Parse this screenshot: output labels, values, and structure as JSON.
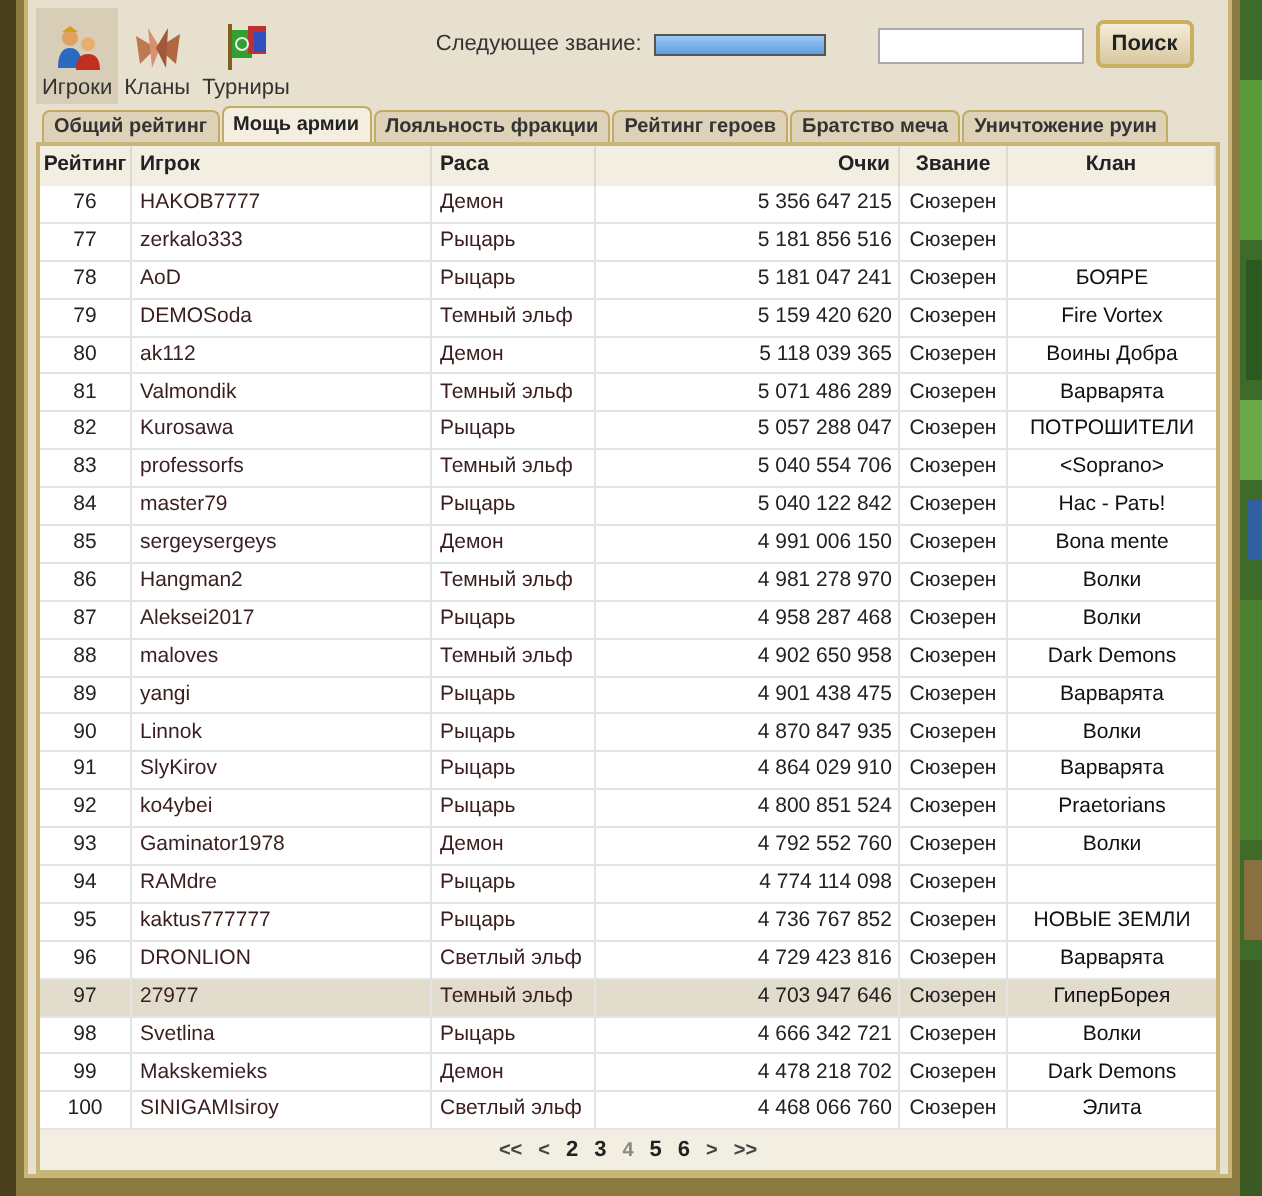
{
  "nav": [
    {
      "kind": "players",
      "label": "Игроки",
      "selected": true
    },
    {
      "kind": "clans",
      "label": "Кланы",
      "selected": false
    },
    {
      "kind": "tournaments",
      "label": "Турниры",
      "selected": false
    }
  ],
  "next_rank": {
    "label": "Следующее звание:",
    "level": 1
  },
  "search": {
    "button": "Поиск"
  },
  "tabs": [
    {
      "label": "Общий рейтинг",
      "selected": false
    },
    {
      "label": "Мощь армии",
      "selected": true
    },
    {
      "label": "Лояльность фракции",
      "selected": false
    },
    {
      "label": "Рейтинг героев",
      "selected": false
    },
    {
      "label": "Братство меча",
      "selected": false
    },
    {
      "label": "Уничтожение руин",
      "selected": false
    }
  ],
  "table": {
    "columns": [
      "Рейтинг",
      "Игрок",
      "Раса",
      "Очки",
      "Звание",
      "Клан"
    ],
    "rows": [
      {
        "rank": "76",
        "player": "HAKOB7777",
        "race": "Демон",
        "points": "5 356 647 215",
        "title": "Сюзерен",
        "clan": "",
        "selected": false
      },
      {
        "rank": "77",
        "player": "zerkalo333",
        "race": "Рыцарь",
        "points": "5 181 856 516",
        "title": "Сюзерен",
        "clan": "",
        "selected": false
      },
      {
        "rank": "78",
        "player": "AoD",
        "race": "Рыцарь",
        "points": "5 181 047 241",
        "title": "Сюзерен",
        "clan": "БОЯРЕ",
        "selected": false
      },
      {
        "rank": "79",
        "player": "DEMOSoda",
        "race": "Темный эльф",
        "points": "5 159 420 620",
        "title": "Сюзерен",
        "clan": "Fire Vortex",
        "selected": false
      },
      {
        "rank": "80",
        "player": "ak112",
        "race": "Демон",
        "points": "5 118 039 365",
        "title": "Сюзерен",
        "clan": "Воины Добра",
        "selected": false
      },
      {
        "rank": "81",
        "player": "Valmondik",
        "race": "Темный эльф",
        "points": "5 071 486 289",
        "title": "Сюзерен",
        "clan": "Варварята",
        "selected": false
      },
      {
        "rank": "82",
        "player": "Kurosawa",
        "race": "Рыцарь",
        "points": "5 057 288 047",
        "title": "Сюзерен",
        "clan": "ПОТРОШИТЕЛИ",
        "selected": false
      },
      {
        "rank": "83",
        "player": "professorfs",
        "race": "Темный эльф",
        "points": "5 040 554 706",
        "title": "Сюзерен",
        "clan": "<Soprano>",
        "selected": false
      },
      {
        "rank": "84",
        "player": "master79",
        "race": "Рыцарь",
        "points": "5 040 122 842",
        "title": "Сюзерен",
        "clan": "Нас - Рать!",
        "selected": false
      },
      {
        "rank": "85",
        "player": "sergeysergeys",
        "race": "Демон",
        "points": "4 991 006 150",
        "title": "Сюзерен",
        "clan": "Bona mente",
        "selected": false
      },
      {
        "rank": "86",
        "player": "Hangman2",
        "race": "Темный эльф",
        "points": "4 981 278 970",
        "title": "Сюзерен",
        "clan": "Волки",
        "selected": false
      },
      {
        "rank": "87",
        "player": "Aleksei2017",
        "race": "Рыцарь",
        "points": "4 958 287 468",
        "title": "Сюзерен",
        "clan": "Волки",
        "selected": false
      },
      {
        "rank": "88",
        "player": "maloves",
        "race": "Темный эльф",
        "points": "4 902 650 958",
        "title": "Сюзерен",
        "clan": "Dark Demons",
        "selected": false
      },
      {
        "rank": "89",
        "player": "yangi",
        "race": "Рыцарь",
        "points": "4 901 438 475",
        "title": "Сюзерен",
        "clan": "Варварята",
        "selected": false
      },
      {
        "rank": "90",
        "player": "Linnok",
        "race": "Рыцарь",
        "points": "4 870 847 935",
        "title": "Сюзерен",
        "clan": "Волки",
        "selected": false
      },
      {
        "rank": "91",
        "player": "SlyKirov",
        "race": "Рыцарь",
        "points": "4 864 029 910",
        "title": "Сюзерен",
        "clan": "Варварята",
        "selected": false
      },
      {
        "rank": "92",
        "player": "ko4ybei",
        "race": "Рыцарь",
        "points": "4 800 851 524",
        "title": "Сюзерен",
        "clan": "Praetorians",
        "selected": false
      },
      {
        "rank": "93",
        "player": "Gaminator1978",
        "race": "Демон",
        "points": "4 792 552 760",
        "title": "Сюзерен",
        "clan": "Волки",
        "selected": false
      },
      {
        "rank": "94",
        "player": "RAMdre",
        "race": "Рыцарь",
        "points": "4 774 114 098",
        "title": "Сюзерен",
        "clan": "",
        "selected": false
      },
      {
        "rank": "95",
        "player": "kaktus777777",
        "race": "Рыцарь",
        "points": "4 736 767 852",
        "title": "Сюзерен",
        "clan": "НОВЫЕ ЗЕМЛИ",
        "selected": false
      },
      {
        "rank": "96",
        "player": "DRONLION",
        "race": "Светлый эльф",
        "points": "4 729 423 816",
        "title": "Сюзерен",
        "clan": "Варварята",
        "selected": false
      },
      {
        "rank": "97",
        "player": "27977",
        "race": "Темный эльф",
        "points": "4 703 947 646",
        "title": "Сюзерен",
        "clan": "ГиперБорея",
        "selected": true
      },
      {
        "rank": "98",
        "player": "Svetlina",
        "race": "Рыцарь",
        "points": "4 666 342 721",
        "title": "Сюзерен",
        "clan": "Волки",
        "selected": false
      },
      {
        "rank": "99",
        "player": "Makskemieks",
        "race": "Демон",
        "points": "4 478 218 702",
        "title": "Сюзерен",
        "clan": "Dark Demons",
        "selected": false
      },
      {
        "rank": "100",
        "player": "SINIGAMIsiroy",
        "race": "Светлый эльф",
        "points": "4 468 066 760",
        "title": "Сюзерен",
        "clan": "Элита",
        "selected": false
      }
    ]
  },
  "pager": [
    {
      "label": "<<",
      "kind": "arrow",
      "selected": false
    },
    {
      "label": "<",
      "kind": "arrow",
      "selected": false
    },
    {
      "label": "2",
      "kind": "page",
      "selected": false
    },
    {
      "label": "3",
      "kind": "page",
      "selected": false
    },
    {
      "label": "4",
      "kind": "page",
      "selected": true
    },
    {
      "label": "5",
      "kind": "page",
      "selected": false
    },
    {
      "label": "6",
      "kind": "page",
      "selected": false
    },
    {
      "label": ">",
      "kind": "arrow",
      "selected": false
    },
    {
      "label": ">>",
      "kind": "arrow",
      "selected": false
    }
  ]
}
